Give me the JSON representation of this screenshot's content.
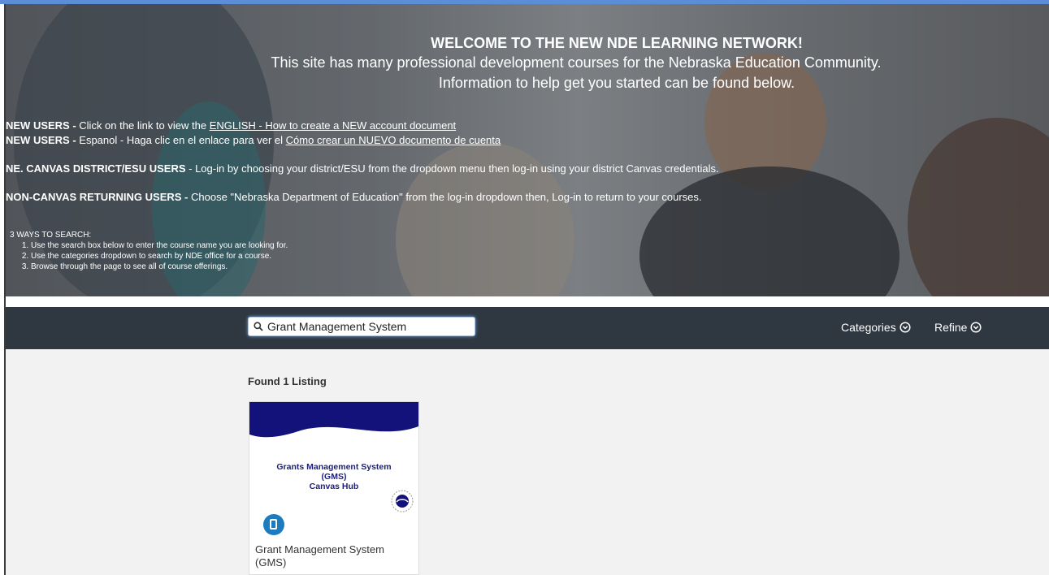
{
  "hero": {
    "welcome_title": "WELCOME TO THE NEW NDE LEARNING NETWORK!",
    "welcome_line2": "This site has many professional development courses for the Nebraska Education Community.",
    "welcome_line3": "Information to help get you started can be found below.",
    "new_users_en": {
      "label": "NEW USERS -",
      "text": " Click on the link to view the ",
      "link": "ENGLISH - How to create a NEW account document"
    },
    "new_users_es": {
      "label": "NEW USERS -",
      "text": " Espanol - Haga clic en el enlace para ver el ",
      "link": "Cómo crear un NUEVO documento de cuenta"
    },
    "canvas_users": {
      "label": "NE. CANVAS DISTRICT/ESU USERS",
      "text": " - Log-in by choosing your district/ESU from the dropdown menu then log-in using your district Canvas credentials."
    },
    "non_canvas_users": {
      "label": "NON-CANVAS RETURNING USERS -",
      "text": " Choose \"Nebraska Department of Education\" from the log-in dropdown then, Log-in to return to your courses."
    },
    "ways_title": "3 WAYS TO SEARCH:",
    "ways": [
      "Use the search box below to enter the course name you are looking for.",
      "Use the categories dropdown to search by NDE office for a course.",
      "Browse through the page to see all of course offerings."
    ]
  },
  "search": {
    "value": "Grant Management System",
    "icon": "search-icon"
  },
  "nav": {
    "categories_label": "Categories",
    "refine_label": "Refine"
  },
  "results": {
    "found_label": "Found 1 Listing",
    "listings": [
      {
        "image_title_line1": "Grants Management System",
        "image_title_line2": "(GMS)",
        "image_title_line3": "Canvas Hub",
        "name": "Grant Management System (GMS)",
        "type_icon": "course-icon"
      }
    ]
  },
  "colors": {
    "navbar": "#2f3740",
    "banner_navy": "#12127a",
    "course_icon": "#1d7cc0"
  }
}
